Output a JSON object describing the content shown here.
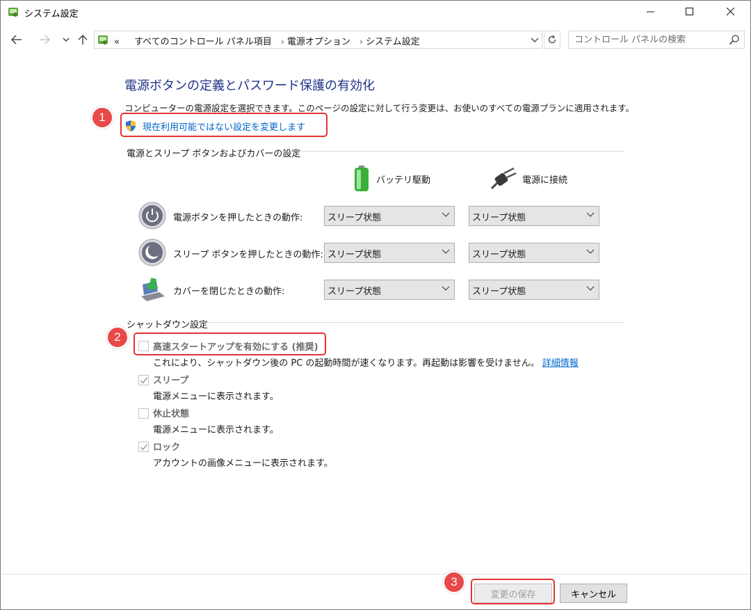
{
  "window": {
    "title": "システム設定",
    "minimize_icon": "minimize-icon",
    "maximize_icon": "maximize-icon",
    "close_icon": "close-icon"
  },
  "navigation": {
    "back_icon": "arrow-left-icon",
    "forward_icon": "arrow-right-icon",
    "recent_icon": "chevron-down-icon",
    "up_icon": "arrow-up-icon",
    "address": {
      "overflow": "«",
      "crumbs": [
        "すべてのコントロール パネル項目",
        "電源オプション",
        "システム設定"
      ]
    },
    "refresh_icon": "refresh-icon",
    "search_placeholder": "コントロール パネルの検索"
  },
  "main": {
    "heading": "電源ボタンの定義とパスワード保護の有効化",
    "description": "コンピューターの電源設定を選択できます。このページの設定に対して行う変更は、お使いのすべての電源プランに適用されます。",
    "admin_link": "現在利用可能ではない設定を変更します",
    "power_section_title": "電源とスリープ ボタンおよびカバーの設定",
    "columns": [
      "バッテリ駆動",
      "電源に接続"
    ],
    "rows": [
      {
        "label": "電源ボタンを押したときの動作:",
        "battery": "スリープ状態",
        "plugged": "スリープ状態"
      },
      {
        "label": "スリープ ボタンを押したときの動作:",
        "battery": "スリープ状態",
        "plugged": "スリープ状態"
      },
      {
        "label": "カバーを閉じたときの動作:",
        "battery": "スリープ状態",
        "plugged": "スリープ状態"
      }
    ],
    "shutdown_section_title": "シャットダウン設定",
    "shutdown_options": [
      {
        "title": "高速スタートアップを有効にする (推奨)",
        "checked": false,
        "description": "これにより、シャットダウン後の PC の起動時間が速くなります。再起動は影響を受けません。",
        "link": "詳細情報"
      },
      {
        "title": "スリープ",
        "checked": true,
        "description": "電源メニューに表示されます。"
      },
      {
        "title": "休止状態",
        "checked": false,
        "description": "電源メニューに表示されます。"
      },
      {
        "title": "ロック",
        "checked": true,
        "description": "アカウントの画像メニューに表示されます。"
      }
    ]
  },
  "annotations": [
    "1",
    "2",
    "3"
  ],
  "footer": {
    "save_label": "変更の保存",
    "cancel_label": "キャンセル"
  },
  "colors": {
    "heading": "#1e3287",
    "link": "#0066cc",
    "highlight": "#e63333",
    "badge": "#e84848"
  }
}
